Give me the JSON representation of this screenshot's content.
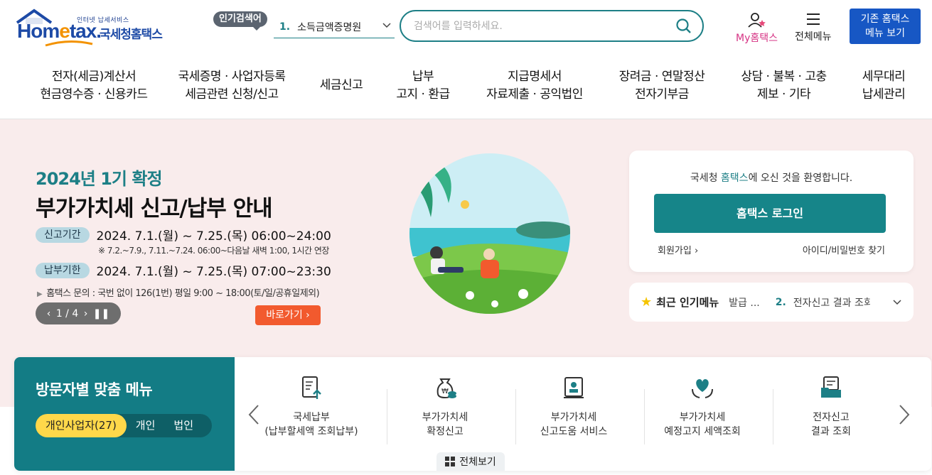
{
  "header": {
    "logo": {
      "small": "인터넷 납세서비스",
      "word_a": "Hom",
      "word_e": "e",
      "word_b": "tax.",
      "sub": "국세청홈택스"
    },
    "popular_badge": "인기검색어",
    "popular_select": {
      "num": "1.",
      "value": "소득금액증명원"
    },
    "search_placeholder": "검색어를 입력하세요.",
    "my_hometax": "My홈택스",
    "all_menu": "전체메뉴",
    "legacy_line1": "기존 홈택스",
    "legacy_line2": "메뉴 보기"
  },
  "nav": [
    {
      "l1": "전자(세금)계산서",
      "l2": "현금영수증 · 신용카드"
    },
    {
      "l1": "국세증명 · 사업자등록",
      "l2": "세금관련 신청/신고"
    },
    {
      "l1": "세금신고",
      "l2": ""
    },
    {
      "l1": "납부",
      "l2": "고지 · 환급"
    },
    {
      "l1": "지급명세서",
      "l2": "자료제출 · 공익법인"
    },
    {
      "l1": "장려금 · 연말정산",
      "l2": "전자기부금"
    },
    {
      "l1": "상담 · 불복 · 고충",
      "l2": "제보 · 기타"
    },
    {
      "l1": "세무대리",
      "l2": "납세관리"
    }
  ],
  "hero": {
    "subtitle": "2024년 1기 확정",
    "title": "부가가치세 신고/납부 안내",
    "period1_label": "신고기간",
    "period1_value": "2024. 7.1.(월) ~ 7.25.(목) 06:00~24:00",
    "period1_note": "※ 7.2.~7.9., 7.11.~7.24. 06:00~다음날 새벽 1:00, 1시간 연장",
    "period2_label": "납부기한",
    "period2_value": "2024. 7.1.(월) ~ 7.25.(목) 07:00~23:30",
    "contact": "홈택스 문의 : 국번 없이 126(1번) 평일 9:00 ~ 18:00(토/일/공휴일제외)",
    "pager": "1 / 4",
    "go_button": "바로가기"
  },
  "login": {
    "welcome_a": "국세청 ",
    "welcome_hl": "홈택스",
    "welcome_b": "에 오신 것을 환영합니다.",
    "login_button": "홈택스 로그인",
    "signup": "회원가입",
    "find_id": "아이디/비밀번호 찾기"
  },
  "popular_menu": {
    "title": "최근 인기메뉴",
    "item1": "발급 ...",
    "num2": "2.",
    "item2": "전자신고 결과 조회"
  },
  "visitor": {
    "title": "방문자별 맞춤 메뉴",
    "segments": [
      "개인사업자(27)",
      "개인",
      "법인"
    ],
    "items": [
      {
        "l1": "국세납부",
        "l2": "(납부할세액 조회납부)"
      },
      {
        "l1": "부가가치세",
        "l2": "확정신고"
      },
      {
        "l1": "부가가치세",
        "l2": "신고도움 서비스"
      },
      {
        "l1": "부가가치세",
        "l2": "예정고지 세액조회"
      },
      {
        "l1": "전자신고",
        "l2": "결과 조회"
      }
    ],
    "view_all": "전체보기"
  },
  "colors": {
    "teal": "#1d7f86",
    "brand_blue": "#1d4aa6",
    "accent_orange": "#f25a2e",
    "legacy_blue": "#1757c4"
  }
}
